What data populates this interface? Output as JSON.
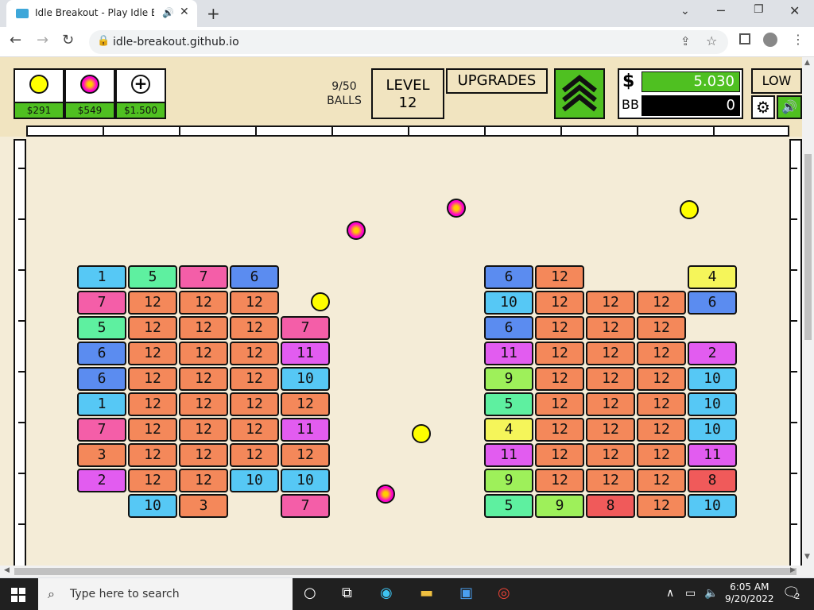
{
  "browser": {
    "tab_title": "Idle Breakout - Play Idle Brea",
    "url": "idle-breakout.github.io"
  },
  "hud": {
    "shop": [
      {
        "price": "$291",
        "icon": "yellow-ball-icon",
        "color": "#ffff00"
      },
      {
        "price": "$549",
        "icon": "magenta-ball-icon",
        "color": "#ff00cc"
      },
      {
        "price": "$1.500",
        "icon": "plus-icon",
        "color": "#ffffff"
      }
    ],
    "balls_count": "9/50",
    "balls_label": "BALLS",
    "level_label": "LEVEL",
    "level_value": "12",
    "upgrades_label": "UPGRADES",
    "money_symbol": "$",
    "money": "5.030",
    "bb_label": "BB",
    "bb": "0",
    "quality": "LOW"
  },
  "bricks": [
    {
      "col": 0,
      "row": 0,
      "v": "1",
      "c": "#56c8f5"
    },
    {
      "col": 1,
      "row": 0,
      "v": "5",
      "c": "#5ef0a0"
    },
    {
      "col": 2,
      "row": 0,
      "v": "7",
      "c": "#f45ea8"
    },
    {
      "col": 3,
      "row": 0,
      "v": "6",
      "c": "#5b8cf0"
    },
    {
      "col": 8,
      "row": 0,
      "v": "6",
      "c": "#5b8cf0"
    },
    {
      "col": 9,
      "row": 0,
      "v": "12",
      "c": "#f4885a"
    },
    {
      "col": 12,
      "row": 0,
      "v": "4",
      "c": "#f5f55a"
    },
    {
      "col": 0,
      "row": 1,
      "v": "7",
      "c": "#f45ea8"
    },
    {
      "col": 1,
      "row": 1,
      "v": "12",
      "c": "#f4885a"
    },
    {
      "col": 2,
      "row": 1,
      "v": "12",
      "c": "#f4885a"
    },
    {
      "col": 3,
      "row": 1,
      "v": "12",
      "c": "#f4885a"
    },
    {
      "col": 8,
      "row": 1,
      "v": "10",
      "c": "#56c8f5"
    },
    {
      "col": 9,
      "row": 1,
      "v": "12",
      "c": "#f4885a"
    },
    {
      "col": 10,
      "row": 1,
      "v": "12",
      "c": "#f4885a"
    },
    {
      "col": 11,
      "row": 1,
      "v": "12",
      "c": "#f4885a"
    },
    {
      "col": 12,
      "row": 1,
      "v": "6",
      "c": "#5b8cf0"
    },
    {
      "col": 0,
      "row": 2,
      "v": "5",
      "c": "#5ef0a0"
    },
    {
      "col": 1,
      "row": 2,
      "v": "12",
      "c": "#f4885a"
    },
    {
      "col": 2,
      "row": 2,
      "v": "12",
      "c": "#f4885a"
    },
    {
      "col": 3,
      "row": 2,
      "v": "12",
      "c": "#f4885a"
    },
    {
      "col": 4,
      "row": 2,
      "v": "7",
      "c": "#f45ea8"
    },
    {
      "col": 8,
      "row": 2,
      "v": "6",
      "c": "#5b8cf0"
    },
    {
      "col": 9,
      "row": 2,
      "v": "12",
      "c": "#f4885a"
    },
    {
      "col": 10,
      "row": 2,
      "v": "12",
      "c": "#f4885a"
    },
    {
      "col": 11,
      "row": 2,
      "v": "12",
      "c": "#f4885a"
    },
    {
      "col": 0,
      "row": 3,
      "v": "6",
      "c": "#5b8cf0"
    },
    {
      "col": 1,
      "row": 3,
      "v": "12",
      "c": "#f4885a"
    },
    {
      "col": 2,
      "row": 3,
      "v": "12",
      "c": "#f4885a"
    },
    {
      "col": 3,
      "row": 3,
      "v": "12",
      "c": "#f4885a"
    },
    {
      "col": 4,
      "row": 3,
      "v": "11",
      "c": "#e25cf0"
    },
    {
      "col": 8,
      "row": 3,
      "v": "11",
      "c": "#e25cf0"
    },
    {
      "col": 9,
      "row": 3,
      "v": "12",
      "c": "#f4885a"
    },
    {
      "col": 10,
      "row": 3,
      "v": "12",
      "c": "#f4885a"
    },
    {
      "col": 11,
      "row": 3,
      "v": "12",
      "c": "#f4885a"
    },
    {
      "col": 12,
      "row": 3,
      "v": "2",
      "c": "#e25cf0"
    },
    {
      "col": 0,
      "row": 4,
      "v": "6",
      "c": "#5b8cf0"
    },
    {
      "col": 1,
      "row": 4,
      "v": "12",
      "c": "#f4885a"
    },
    {
      "col": 2,
      "row": 4,
      "v": "12",
      "c": "#f4885a"
    },
    {
      "col": 3,
      "row": 4,
      "v": "12",
      "c": "#f4885a"
    },
    {
      "col": 4,
      "row": 4,
      "v": "10",
      "c": "#56c8f5"
    },
    {
      "col": 8,
      "row": 4,
      "v": "9",
      "c": "#9ef05a"
    },
    {
      "col": 9,
      "row": 4,
      "v": "12",
      "c": "#f4885a"
    },
    {
      "col": 10,
      "row": 4,
      "v": "12",
      "c": "#f4885a"
    },
    {
      "col": 11,
      "row": 4,
      "v": "12",
      "c": "#f4885a"
    },
    {
      "col": 12,
      "row": 4,
      "v": "10",
      "c": "#56c8f5"
    },
    {
      "col": 0,
      "row": 5,
      "v": "1",
      "c": "#56c8f5"
    },
    {
      "col": 1,
      "row": 5,
      "v": "12",
      "c": "#f4885a"
    },
    {
      "col": 2,
      "row": 5,
      "v": "12",
      "c": "#f4885a"
    },
    {
      "col": 3,
      "row": 5,
      "v": "12",
      "c": "#f4885a"
    },
    {
      "col": 4,
      "row": 5,
      "v": "12",
      "c": "#f4885a"
    },
    {
      "col": 8,
      "row": 5,
      "v": "5",
      "c": "#5ef0a0"
    },
    {
      "col": 9,
      "row": 5,
      "v": "12",
      "c": "#f4885a"
    },
    {
      "col": 10,
      "row": 5,
      "v": "12",
      "c": "#f4885a"
    },
    {
      "col": 11,
      "row": 5,
      "v": "12",
      "c": "#f4885a"
    },
    {
      "col": 12,
      "row": 5,
      "v": "10",
      "c": "#56c8f5"
    },
    {
      "col": 0,
      "row": 6,
      "v": "7",
      "c": "#f45ea8"
    },
    {
      "col": 1,
      "row": 6,
      "v": "12",
      "c": "#f4885a"
    },
    {
      "col": 2,
      "row": 6,
      "v": "12",
      "c": "#f4885a"
    },
    {
      "col": 3,
      "row": 6,
      "v": "12",
      "c": "#f4885a"
    },
    {
      "col": 4,
      "row": 6,
      "v": "11",
      "c": "#e25cf0"
    },
    {
      "col": 8,
      "row": 6,
      "v": "4",
      "c": "#f5f55a"
    },
    {
      "col": 9,
      "row": 6,
      "v": "12",
      "c": "#f4885a"
    },
    {
      "col": 10,
      "row": 6,
      "v": "12",
      "c": "#f4885a"
    },
    {
      "col": 11,
      "row": 6,
      "v": "12",
      "c": "#f4885a"
    },
    {
      "col": 12,
      "row": 6,
      "v": "10",
      "c": "#56c8f5"
    },
    {
      "col": 0,
      "row": 7,
      "v": "3",
      "c": "#f4885a"
    },
    {
      "col": 1,
      "row": 7,
      "v": "12",
      "c": "#f4885a"
    },
    {
      "col": 2,
      "row": 7,
      "v": "12",
      "c": "#f4885a"
    },
    {
      "col": 3,
      "row": 7,
      "v": "12",
      "c": "#f4885a"
    },
    {
      "col": 4,
      "row": 7,
      "v": "12",
      "c": "#f4885a"
    },
    {
      "col": 8,
      "row": 7,
      "v": "11",
      "c": "#e25cf0"
    },
    {
      "col": 9,
      "row": 7,
      "v": "12",
      "c": "#f4885a"
    },
    {
      "col": 10,
      "row": 7,
      "v": "12",
      "c": "#f4885a"
    },
    {
      "col": 11,
      "row": 7,
      "v": "12",
      "c": "#f4885a"
    },
    {
      "col": 12,
      "row": 7,
      "v": "11",
      "c": "#e25cf0"
    },
    {
      "col": 0,
      "row": 8,
      "v": "2",
      "c": "#e25cf0"
    },
    {
      "col": 1,
      "row": 8,
      "v": "12",
      "c": "#f4885a"
    },
    {
      "col": 2,
      "row": 8,
      "v": "12",
      "c": "#f4885a"
    },
    {
      "col": 3,
      "row": 8,
      "v": "10",
      "c": "#56c8f5"
    },
    {
      "col": 4,
      "row": 8,
      "v": "10",
      "c": "#56c8f5"
    },
    {
      "col": 8,
      "row": 8,
      "v": "9",
      "c": "#9ef05a"
    },
    {
      "col": 9,
      "row": 8,
      "v": "12",
      "c": "#f4885a"
    },
    {
      "col": 10,
      "row": 8,
      "v": "12",
      "c": "#f4885a"
    },
    {
      "col": 11,
      "row": 8,
      "v": "12",
      "c": "#f4885a"
    },
    {
      "col": 12,
      "row": 8,
      "v": "8",
      "c": "#f05a5a"
    },
    {
      "col": 1,
      "row": 9,
      "v": "10",
      "c": "#56c8f5"
    },
    {
      "col": 2,
      "row": 9,
      "v": "3",
      "c": "#f4885a"
    },
    {
      "col": 4,
      "row": 9,
      "v": "7",
      "c": "#f45ea8"
    },
    {
      "col": 8,
      "row": 9,
      "v": "5",
      "c": "#5ef0a0"
    },
    {
      "col": 9,
      "row": 9,
      "v": "9",
      "c": "#9ef05a"
    },
    {
      "col": 10,
      "row": 9,
      "v": "8",
      "c": "#f05a5a"
    },
    {
      "col": 11,
      "row": 9,
      "v": "12",
      "c": "#f4885a"
    },
    {
      "col": 12,
      "row": 9,
      "v": "10",
      "c": "#56c8f5"
    }
  ],
  "balls": [
    {
      "type": "magenta",
      "color": "#ff00cc"
    },
    {
      "type": "magenta",
      "color": "#ff00cc"
    },
    {
      "type": "yellow",
      "color": "#ffff00"
    },
    {
      "type": "yellow",
      "color": "#ffff00"
    },
    {
      "type": "yellow",
      "color": "#ffff00"
    },
    {
      "type": "magenta",
      "color": "#ff00cc"
    }
  ],
  "taskbar": {
    "search_placeholder": "Type here to search",
    "time": "6:05 AM",
    "date": "9/20/2022",
    "notifications": "2"
  },
  "colors": {
    "game_bg": "#f4ecd7",
    "accent_green": "#4fc021"
  }
}
